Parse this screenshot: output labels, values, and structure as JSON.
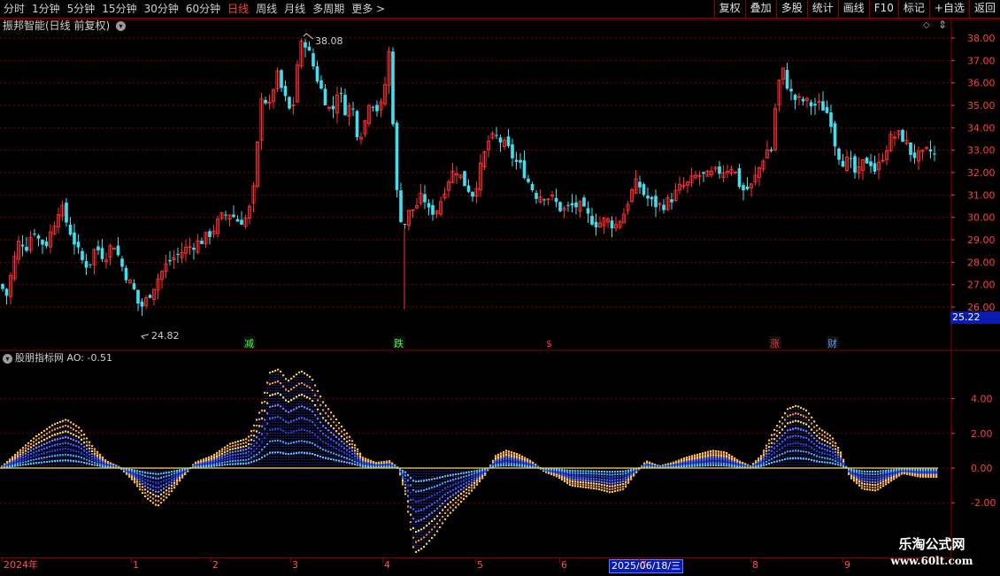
{
  "toolbar": {
    "periods": [
      {
        "label": "分时",
        "active": false
      },
      {
        "label": "1分钟",
        "active": false
      },
      {
        "label": "5分钟",
        "active": false
      },
      {
        "label": "15分钟",
        "active": false
      },
      {
        "label": "30分钟",
        "active": false
      },
      {
        "label": "60分钟",
        "active": false
      },
      {
        "label": "日线",
        "active": true
      },
      {
        "label": "周线",
        "active": false
      },
      {
        "label": "月线",
        "active": false
      },
      {
        "label": "多周期",
        "active": false
      },
      {
        "label": "更多",
        "active": false
      }
    ],
    "more_arrow": ">",
    "buttons": [
      "复权",
      "叠加",
      "多股",
      "统计",
      "画线",
      "F10",
      "标记",
      "+自选",
      "返回"
    ]
  },
  "stock": {
    "title": "振邦智能(日线 前复权)"
  },
  "indicator": {
    "title": "股朋指标网 AO: -0.51"
  },
  "colors": {
    "up": "#ff3030",
    "down": "#40e0f0",
    "grid": "#8b0000",
    "axis": "#ff4040",
    "bg": "#000000",
    "highlight": "#0a1cb0"
  },
  "current_price": "25.22",
  "months": [
    {
      "label": "2024年",
      "pos": 2
    },
    {
      "label": "1",
      "pos": 148
    },
    {
      "label": "2",
      "pos": 238
    },
    {
      "label": "3",
      "pos": 328
    },
    {
      "label": "4",
      "pos": 432
    },
    {
      "label": "5",
      "pos": 537
    },
    {
      "label": "6",
      "pos": 632
    },
    {
      "label": "7",
      "pos": 722
    },
    {
      "label": "8",
      "pos": 848
    },
    {
      "label": "9",
      "pos": 952
    }
  ],
  "date_highlight": {
    "label": "2025/06/18/三"
  },
  "watermark": {
    "line1": "乐淘公式网",
    "line2": "www.60lt.com"
  },
  "chart_data": [
    {
      "type": "candlestick",
      "title": "振邦智能(日线 前复权)",
      "ylim": [
        25.5,
        38.4
      ],
      "yticks": [
        "26.00",
        "27.00",
        "28.00",
        "29.00",
        "30.00",
        "31.00",
        "32.00",
        "33.00",
        "34.00",
        "35.00",
        "36.00",
        "37.00",
        "38.00"
      ],
      "close_path": [
        [
          0,
          27.0
        ],
        [
          8,
          26.5
        ],
        [
          14,
          27.8
        ],
        [
          22,
          29.0
        ],
        [
          30,
          28.7
        ],
        [
          38,
          29.5
        ],
        [
          45,
          28.9
        ],
        [
          52,
          28.8
        ],
        [
          60,
          29.6
        ],
        [
          68,
          30.6
        ],
        [
          75,
          29.8
        ],
        [
          82,
          29.1
        ],
        [
          92,
          28.1
        ],
        [
          100,
          27.8
        ],
        [
          108,
          28.7
        ],
        [
          118,
          28.2
        ],
        [
          128,
          28.9
        ],
        [
          138,
          27.8
        ],
        [
          145,
          27.2
        ],
        [
          152,
          26.7
        ],
        [
          158,
          25.9
        ],
        [
          165,
          26.3
        ],
        [
          172,
          26.8
        ],
        [
          180,
          27.4
        ],
        [
          190,
          28.0
        ],
        [
          200,
          28.3
        ],
        [
          210,
          28.6
        ],
        [
          220,
          28.8
        ],
        [
          230,
          29.0
        ],
        [
          240,
          29.4
        ],
        [
          250,
          30.0
        ],
        [
          260,
          30.2
        ],
        [
          270,
          29.8
        ],
        [
          280,
          30.0
        ],
        [
          288,
          31.5
        ],
        [
          295,
          35.5
        ],
        [
          305,
          34.9
        ],
        [
          312,
          36.5
        ],
        [
          320,
          35.5
        ],
        [
          330,
          34.5
        ],
        [
          338,
          37.6
        ],
        [
          345,
          37.8
        ],
        [
          352,
          37.0
        ],
        [
          360,
          36.0
        ],
        [
          368,
          35.2
        ],
        [
          375,
          34.6
        ],
        [
          382,
          35.8
        ],
        [
          390,
          34.8
        ],
        [
          398,
          35.0
        ],
        [
          405,
          33.5
        ],
        [
          412,
          34.2
        ],
        [
          418,
          35.4
        ],
        [
          425,
          34.8
        ],
        [
          432,
          35.0
        ],
        [
          440,
          37.5
        ],
        [
          448,
          31.2
        ],
        [
          455,
          29.5
        ],
        [
          462,
          30.2
        ],
        [
          470,
          30.5
        ],
        [
          478,
          31.0
        ],
        [
          485,
          30.2
        ],
        [
          495,
          30.4
        ],
        [
          505,
          31.6
        ],
        [
          515,
          32.2
        ],
        [
          525,
          31.5
        ],
        [
          535,
          31.0
        ],
        [
          545,
          32.5
        ],
        [
          552,
          33.4
        ],
        [
          560,
          33.6
        ],
        [
          568,
          33.3
        ],
        [
          575,
          33.0
        ],
        [
          582,
          32.5
        ],
        [
          590,
          32.2
        ],
        [
          598,
          31.5
        ],
        [
          606,
          31.0
        ],
        [
          615,
          31.0
        ],
        [
          625,
          30.8
        ],
        [
          635,
          30.3
        ],
        [
          645,
          30.5
        ],
        [
          655,
          30.5
        ],
        [
          665,
          30.0
        ],
        [
          675,
          29.7
        ],
        [
          685,
          29.9
        ],
        [
          695,
          29.6
        ],
        [
          705,
          30.2
        ],
        [
          712,
          31.0
        ],
        [
          720,
          31.6
        ],
        [
          728,
          31.0
        ],
        [
          738,
          30.6
        ],
        [
          748,
          30.5
        ],
        [
          758,
          30.8
        ],
        [
          768,
          31.3
        ],
        [
          778,
          31.5
        ],
        [
          788,
          31.9
        ],
        [
          798,
          31.8
        ],
        [
          808,
          32.0
        ],
        [
          818,
          32.1
        ],
        [
          828,
          32.3
        ],
        [
          838,
          31.2
        ],
        [
          848,
          31.3
        ],
        [
          858,
          32.2
        ],
        [
          866,
          33.0
        ],
        [
          872,
          33.0
        ],
        [
          878,
          35.8
        ],
        [
          885,
          36.5
        ],
        [
          892,
          35.6
        ],
        [
          900,
          35.2
        ],
        [
          908,
          35.2
        ],
        [
          918,
          35.0
        ],
        [
          928,
          35.0
        ],
        [
          938,
          34.5
        ],
        [
          945,
          33.0
        ],
        [
          952,
          32.5
        ],
        [
          960,
          32.5
        ],
        [
          968,
          31.8
        ],
        [
          975,
          32.4
        ],
        [
          982,
          32.6
        ],
        [
          990,
          32.0
        ],
        [
          998,
          32.8
        ],
        [
          1006,
          33.5
        ],
        [
          1014,
          33.7
        ],
        [
          1022,
          33.5
        ],
        [
          1030,
          32.8
        ],
        [
          1040,
          32.7
        ],
        [
          1050,
          33.0
        ],
        [
          1057,
          32.7
        ]
      ],
      "annotations": [
        {
          "label": "38.08"
        },
        {
          "label": "24.82"
        }
      ],
      "events": [
        {
          "label": "减",
          "color": "#40ff40"
        },
        {
          "label": "跌",
          "color": "#40ff40"
        },
        {
          "label": "$",
          "color": "#ff3030"
        },
        {
          "label": "涨",
          "color": "#ff3030"
        },
        {
          "label": "财",
          "color": "#4aa0ff"
        }
      ]
    },
    {
      "type": "area",
      "title": "股朋指标网 AO: -0.51",
      "ylim": [
        -3.0,
        6.0
      ],
      "yticks": [
        "4.00",
        "2.00",
        "0.00",
        "-2.00"
      ],
      "series": [
        {
          "name": "AO",
          "current": -0.51
        }
      ],
      "ao_path": [
        [
          0,
          0.0
        ],
        [
          20,
          0.9
        ],
        [
          40,
          1.8
        ],
        [
          60,
          2.5
        ],
        [
          75,
          2.8
        ],
        [
          90,
          2.3
        ],
        [
          105,
          1.2
        ],
        [
          120,
          0.4
        ],
        [
          135,
          0.05
        ],
        [
          150,
          -0.7
        ],
        [
          165,
          -1.7
        ],
        [
          178,
          -2.2
        ],
        [
          190,
          -1.6
        ],
        [
          205,
          -0.6
        ],
        [
          220,
          0.3
        ],
        [
          240,
          0.7
        ],
        [
          260,
          1.4
        ],
        [
          280,
          1.7
        ],
        [
          292,
          3.0
        ],
        [
          305,
          5.5
        ],
        [
          315,
          5.7
        ],
        [
          325,
          5.0
        ],
        [
          340,
          5.6
        ],
        [
          352,
          5.2
        ],
        [
          365,
          3.8
        ],
        [
          380,
          2.8
        ],
        [
          395,
          1.8
        ],
        [
          410,
          0.6
        ],
        [
          425,
          0.3
        ],
        [
          440,
          0.4
        ],
        [
          450,
          0.0
        ],
        [
          458,
          -1.5
        ],
        [
          468,
          -4.9
        ],
        [
          478,
          -4.6
        ],
        [
          492,
          -3.8
        ],
        [
          505,
          -2.8
        ],
        [
          520,
          -2.0
        ],
        [
          535,
          -1.2
        ],
        [
          548,
          -0.4
        ],
        [
          560,
          0.7
        ],
        [
          572,
          1.0
        ],
        [
          585,
          0.8
        ],
        [
          600,
          0.4
        ],
        [
          615,
          -0.2
        ],
        [
          630,
          -0.5
        ],
        [
          645,
          -1.0
        ],
        [
          660,
          -1.1
        ],
        [
          675,
          -1.2
        ],
        [
          690,
          -1.4
        ],
        [
          705,
          -1.2
        ],
        [
          718,
          -0.3
        ],
        [
          730,
          0.4
        ],
        [
          745,
          0.1
        ],
        [
          760,
          0.3
        ],
        [
          775,
          0.6
        ],
        [
          790,
          0.8
        ],
        [
          805,
          1.0
        ],
        [
          820,
          0.9
        ],
        [
          835,
          0.4
        ],
        [
          848,
          0.1
        ],
        [
          860,
          0.7
        ],
        [
          875,
          2.2
        ],
        [
          890,
          3.4
        ],
        [
          900,
          3.6
        ],
        [
          912,
          3.3
        ],
        [
          925,
          2.3
        ],
        [
          940,
          1.8
        ],
        [
          950,
          0.9
        ],
        [
          960,
          -0.5
        ],
        [
          975,
          -1.2
        ],
        [
          990,
          -1.3
        ],
        [
          1005,
          -0.8
        ],
        [
          1020,
          -0.3
        ],
        [
          1040,
          -0.5
        ],
        [
          1058,
          -0.51
        ]
      ]
    }
  ]
}
